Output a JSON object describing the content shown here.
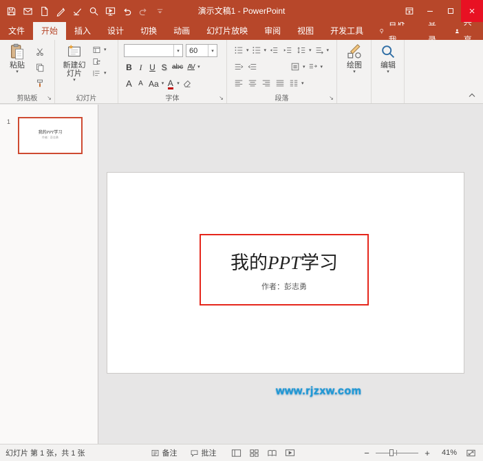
{
  "colors": {
    "accent": "#B7472A",
    "close_red": "#E81123",
    "annotation_red": "#E5261B",
    "selection_border": "#CE4A31",
    "watermark_blue": "#1E9BD7"
  },
  "titlebar": {
    "title": "演示文稿1 - PowerPoint"
  },
  "tabs": {
    "file": "文件",
    "home": "开始",
    "insert": "插入",
    "design": "设计",
    "transitions": "切换",
    "animations": "动画",
    "slideshow": "幻灯片放映",
    "review": "审阅",
    "view": "视图",
    "developer": "开发工具",
    "tellme": "告诉我...",
    "signin": "登录",
    "share": "共享"
  },
  "ribbon": {
    "clipboard": {
      "label": "剪贴板",
      "paste": "粘贴"
    },
    "slides": {
      "label": "幻灯片",
      "new_slide": "新建幻灯片"
    },
    "font": {
      "label": "字体",
      "font_name": "",
      "font_size": "60",
      "bold": "B",
      "italic": "I",
      "underline": "U",
      "shadow": "S",
      "strikethrough": "abc",
      "char_spacing": "AV",
      "grow": "A",
      "shrink": "A",
      "change_case": "Aa",
      "color": "A"
    },
    "paragraph": {
      "label": "段落"
    },
    "drawing": {
      "label": "绘图"
    },
    "editing": {
      "label": "编辑"
    }
  },
  "thumbnail_panel": {
    "slide_number": "1",
    "thumb_title_pre": "我的",
    "thumb_title_italic": "PPT",
    "thumb_title_post": "学习",
    "thumb_subtitle": "作者：彭志勇"
  },
  "slide": {
    "title_pre": "我的",
    "title_italic": "PPT",
    "title_post": "学习",
    "subtitle": "作者：彭志勇"
  },
  "watermark": "www.rjzxw.com",
  "statusbar": {
    "slide_info": "幻灯片 第 1 张，共 1 张",
    "notes": "备注",
    "comments": "批注",
    "zoom_out": "−",
    "zoom_in": "+",
    "zoom_percent": "41%"
  }
}
